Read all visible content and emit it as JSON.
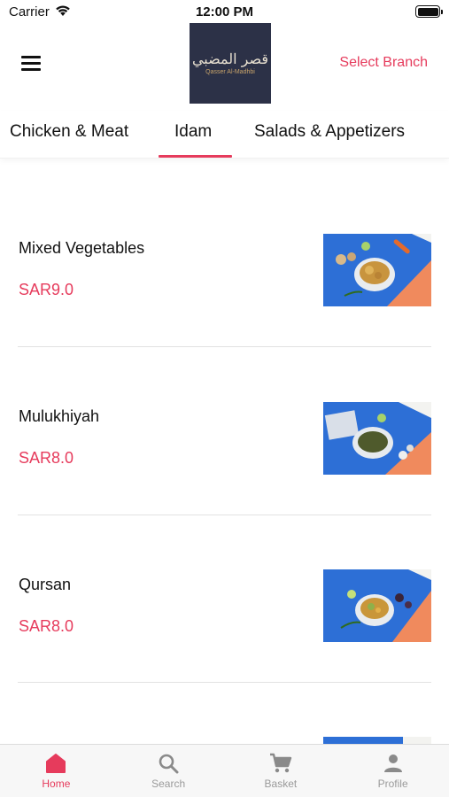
{
  "status_bar": {
    "carrier": "Carrier",
    "time": "12:00 PM",
    "wifi_icon": "wifi-icon",
    "battery_icon": "battery-icon"
  },
  "header": {
    "menu_icon": "hamburger-menu-icon",
    "logo_arabic": "قصر المضبي",
    "logo_english": "Qasser Al-Madhbi",
    "select_branch": "Select Branch"
  },
  "categories": {
    "tabs": [
      {
        "label": "Chicken & Meat"
      },
      {
        "label": "Idam",
        "active": true
      },
      {
        "label": "Salads & Appetizers"
      }
    ]
  },
  "menu_items": [
    {
      "name": "Mixed Vegetables",
      "price": "SAR9.0"
    },
    {
      "name": "Mulukhiyah",
      "price": "SAR8.0"
    },
    {
      "name": "Qursan",
      "price": "SAR8.0"
    }
  ],
  "tab_bar": {
    "items": [
      {
        "label": "Home",
        "icon": "home-icon",
        "active": true
      },
      {
        "label": "Search",
        "icon": "search-icon"
      },
      {
        "label": "Basket",
        "icon": "cart-icon"
      },
      {
        "label": "Profile",
        "icon": "profile-icon"
      }
    ]
  },
  "colors": {
    "accent": "#e63b5c",
    "logo_bg": "#2c3147",
    "photo_blue": "#2d6fd6",
    "photo_orange": "#f08a5d"
  }
}
